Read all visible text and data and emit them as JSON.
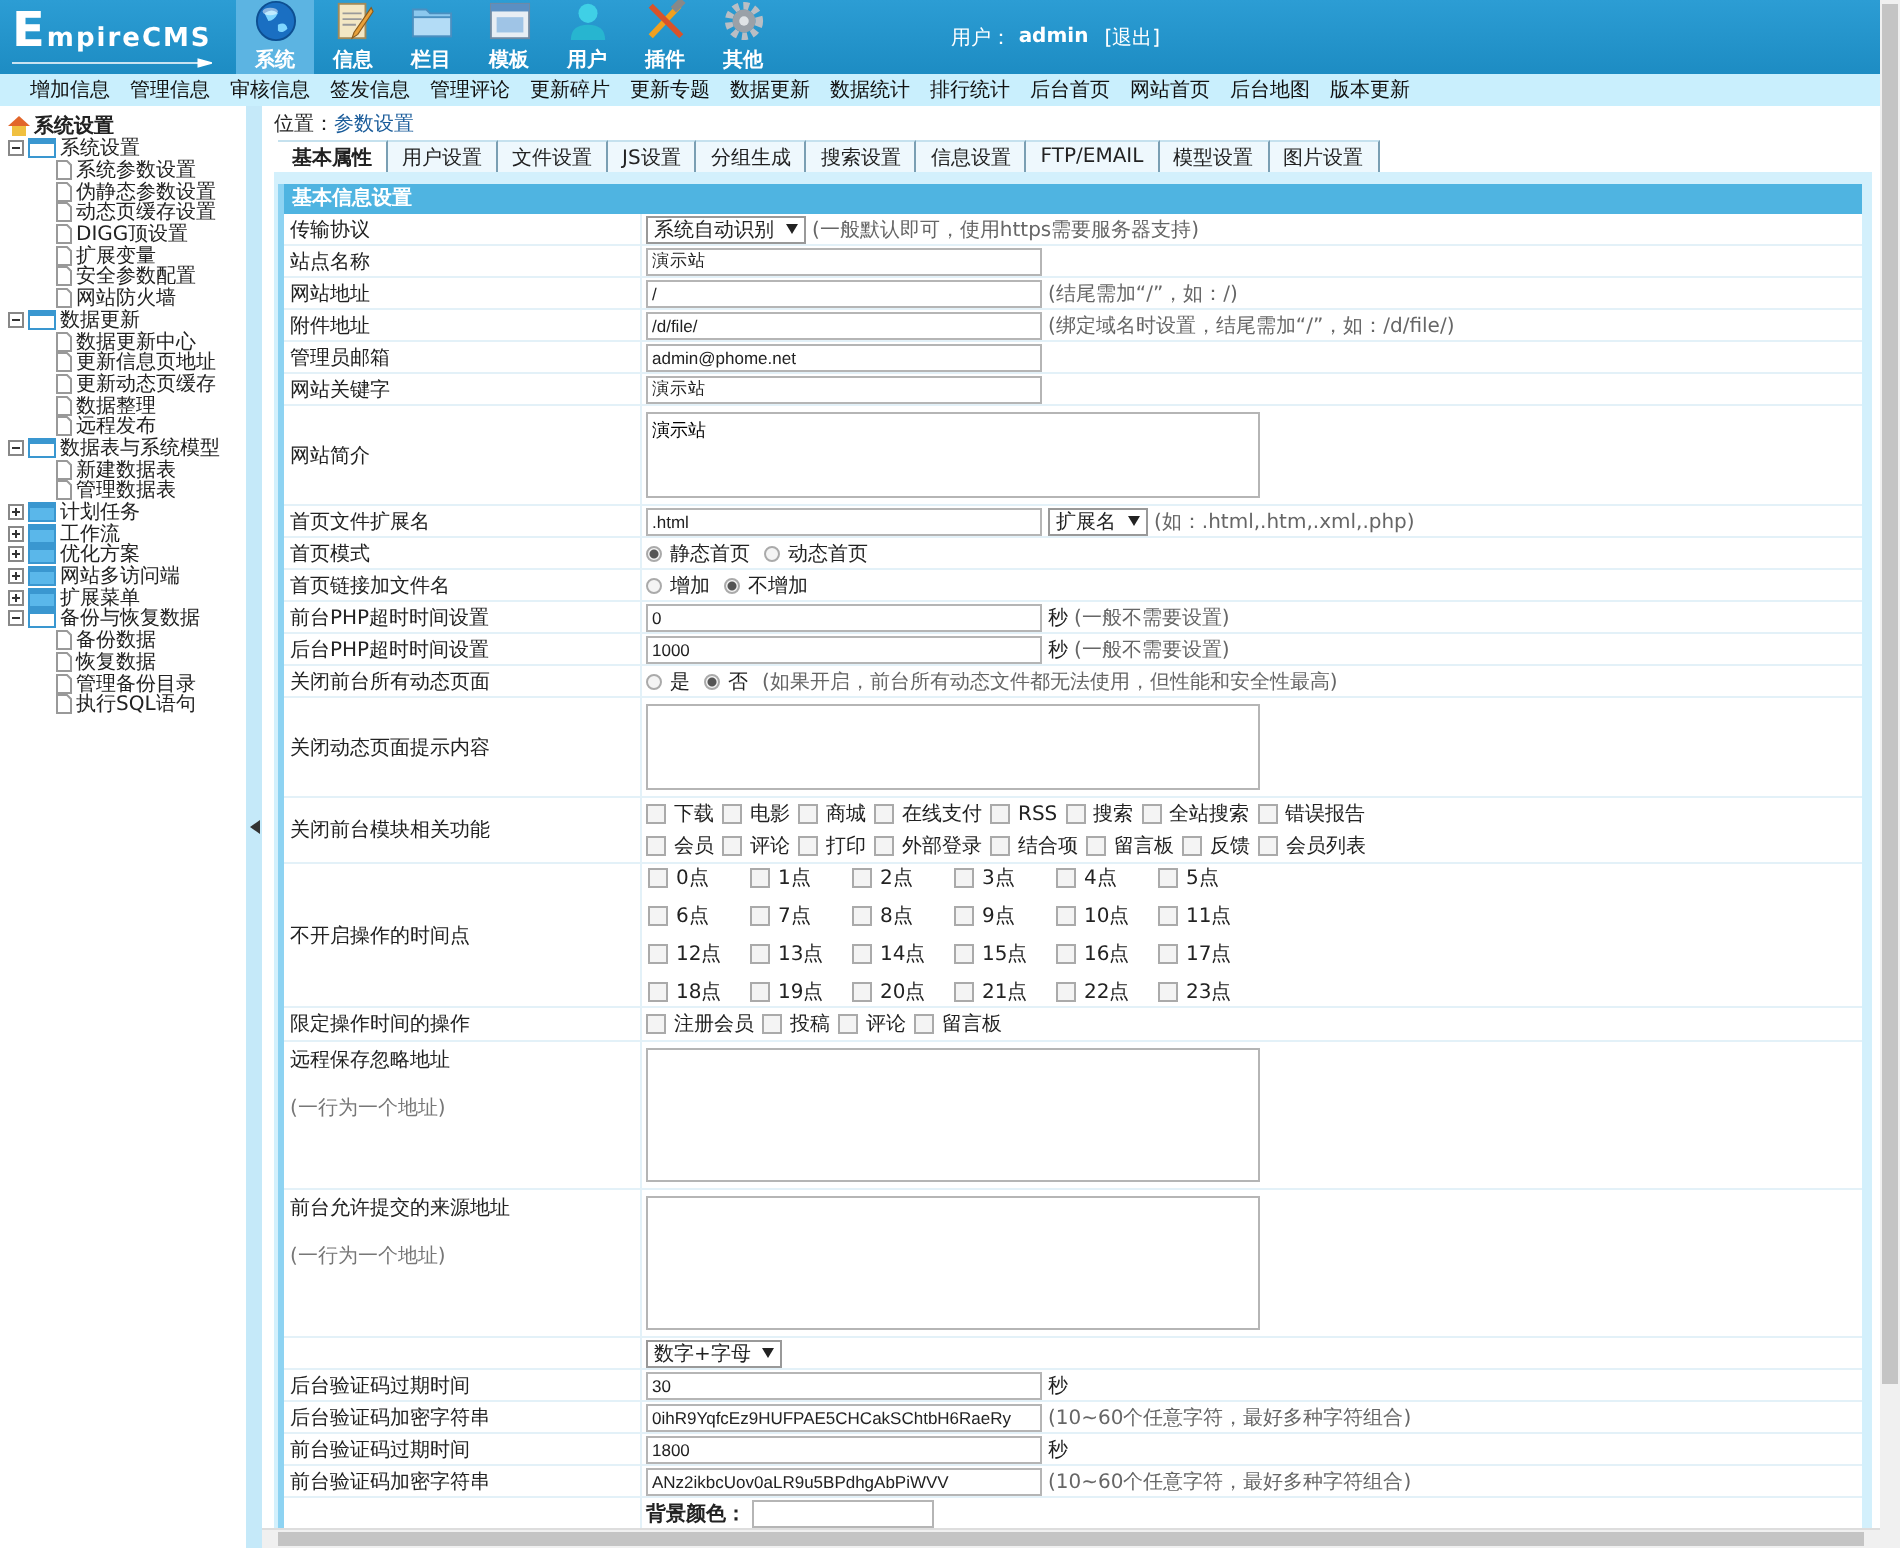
{
  "header": {
    "logo": "EmpireCMS",
    "modules": [
      {
        "label": "系统",
        "selected": true
      },
      {
        "label": "信息",
        "selected": false
      },
      {
        "label": "栏目",
        "selected": false
      },
      {
        "label": "模板",
        "selected": false
      },
      {
        "label": "用户",
        "selected": false
      },
      {
        "label": "插件",
        "selected": false
      },
      {
        "label": "其他",
        "selected": false
      }
    ],
    "user_label": "用户：",
    "user": "admin",
    "logout": "[退出]"
  },
  "menu": [
    "增加信息",
    "管理信息",
    "审核信息",
    "签发信息",
    "管理评论",
    "更新碎片",
    "更新专题",
    "数据更新",
    "数据统计",
    "排行统计",
    "后台首页",
    "网站首页",
    "后台地图",
    "版本更新"
  ],
  "sidebar": {
    "root": "系统设置",
    "items": [
      {
        "label": "系统设置",
        "expanded": true,
        "children": [
          {
            "label": "系统参数设置"
          },
          {
            "label": "伪静态参数设置"
          },
          {
            "label": "动态页缓存设置"
          },
          {
            "label": "DIGG顶设置"
          },
          {
            "label": "扩展变量"
          },
          {
            "label": "安全参数配置"
          },
          {
            "label": "网站防火墙"
          }
        ]
      },
      {
        "label": "数据更新",
        "expanded": true,
        "children": [
          {
            "label": "数据更新中心"
          },
          {
            "label": "更新信息页地址"
          },
          {
            "label": "更新动态页缓存"
          },
          {
            "label": "数据整理"
          },
          {
            "label": "远程发布"
          }
        ]
      },
      {
        "label": "数据表与系统模型",
        "expanded": true,
        "children": [
          {
            "label": "新建数据表"
          },
          {
            "label": "管理数据表"
          }
        ]
      },
      {
        "label": "计划任务",
        "expanded": false
      },
      {
        "label": "工作流",
        "expanded": false
      },
      {
        "label": "优化方案",
        "expanded": false
      },
      {
        "label": "网站多访问端",
        "expanded": false
      },
      {
        "label": "扩展菜单",
        "expanded": false
      },
      {
        "label": "备份与恢复数据",
        "expanded": true,
        "children": [
          {
            "label": "备份数据"
          },
          {
            "label": "恢复数据"
          },
          {
            "label": "管理备份目录"
          },
          {
            "label": "执行SQL语句"
          }
        ]
      }
    ]
  },
  "location": {
    "label": "位置：",
    "link": "参数设置"
  },
  "tabs": [
    {
      "label": "基本属性",
      "selected": true
    },
    {
      "label": "用户设置",
      "selected": false
    },
    {
      "label": "文件设置",
      "selected": false
    },
    {
      "label": "JS设置",
      "selected": false
    },
    {
      "label": "分组生成",
      "selected": false
    },
    {
      "label": "搜索设置",
      "selected": false
    },
    {
      "label": "信息设置",
      "selected": false
    },
    {
      "label": "FTP/EMAIL",
      "selected": false
    },
    {
      "label": "模型设置",
      "selected": false
    },
    {
      "label": "图片设置",
      "selected": false
    }
  ],
  "section_title": "基本信息设置",
  "rows": [
    {
      "kind": "select",
      "label": "传输协议",
      "value": "系统自动识别",
      "note": "(一般默认即可，使用https需要服务器支持)"
    },
    {
      "kind": "text",
      "label": "站点名称",
      "value": "演示站"
    },
    {
      "kind": "text",
      "label": "网站地址",
      "value": "/",
      "note": "(结尾需加“/”，如：/)"
    },
    {
      "kind": "text",
      "label": "附件地址",
      "value": "/d/file/",
      "note": "(绑定域名时设置，结尾需加“/”，如：/d/file/)"
    },
    {
      "kind": "text",
      "label": "管理员邮箱",
      "value": "admin@phome.net"
    },
    {
      "kind": "text",
      "label": "网站关键字",
      "value": "演示站"
    },
    {
      "kind": "textarea",
      "label": "网站简介",
      "value": "演示站"
    },
    {
      "kind": "text_select",
      "label": "首页文件扩展名",
      "value": ".html",
      "select": "扩展名",
      "note": "(如：.html,.htm,.xml,.php)"
    },
    {
      "kind": "radio",
      "label": "首页模式",
      "options": [
        {
          "label": "静态首页",
          "selected": true
        },
        {
          "label": "动态首页",
          "selected": false
        }
      ]
    },
    {
      "kind": "radio",
      "label": "首页链接加文件名",
      "options": [
        {
          "label": "增加",
          "selected": false
        },
        {
          "label": "不增加",
          "selected": true
        }
      ]
    },
    {
      "kind": "text",
      "label": "前台PHP超时时间设置",
      "value": "0",
      "unit": "秒",
      "note": "(一般不需要设置)"
    },
    {
      "kind": "text",
      "label": "后台PHP超时时间设置",
      "value": "1000",
      "unit": "秒",
      "note": "(一般不需要设置)"
    },
    {
      "kind": "radio",
      "label": "关闭前台所有动态页面",
      "options": [
        {
          "label": "是",
          "selected": false
        },
        {
          "label": "否",
          "selected": true
        }
      ],
      "note": "(如果开启，前台所有动态文件都无法使用，但性能和安全性最高)"
    },
    {
      "kind": "textarea",
      "label": "关闭动态页面提示内容"
    },
    {
      "kind": "checkboxes",
      "label": "关闭前台模块相关功能",
      "options": [
        {
          "label": "下载",
          "checked": false
        },
        {
          "label": "电影",
          "checked": false
        },
        {
          "label": "商城",
          "checked": false
        },
        {
          "label": "在线支付",
          "checked": false
        },
        {
          "label": "RSS",
          "checked": false
        },
        {
          "label": "搜索",
          "checked": false
        },
        {
          "label": "全站搜索",
          "checked": false
        },
        {
          "label": "错误报告",
          "checked": false
        },
        {
          "label": "会员",
          "checked": false
        },
        {
          "label": "评论",
          "checked": false
        },
        {
          "label": "打印",
          "checked": false
        },
        {
          "label": "外部登录",
          "checked": false
        },
        {
          "label": "结合项",
          "checked": false
        },
        {
          "label": "留言板",
          "checked": false
        },
        {
          "label": "反馈",
          "checked": false
        },
        {
          "label": "会员列表",
          "checked": false
        }
      ]
    },
    {
      "kind": "grid",
      "label": "不开启操作的时间点",
      "options": [
        {
          "label": "0点",
          "checked": false
        },
        {
          "label": "1点",
          "checked": false
        },
        {
          "label": "2点",
          "checked": false
        },
        {
          "label": "3点",
          "checked": false
        },
        {
          "label": "4点",
          "checked": false
        },
        {
          "label": "5点",
          "checked": false
        },
        {
          "label": "6点",
          "checked": false
        },
        {
          "label": "7点",
          "checked": false
        },
        {
          "label": "8点",
          "checked": false
        },
        {
          "label": "9点",
          "checked": false
        },
        {
          "label": "10点",
          "checked": false
        },
        {
          "label": "11点",
          "checked": false
        },
        {
          "label": "12点",
          "checked": false
        },
        {
          "label": "13点",
          "checked": false
        },
        {
          "label": "14点",
          "checked": false
        },
        {
          "label": "15点",
          "checked": false
        },
        {
          "label": "16点",
          "checked": false
        },
        {
          "label": "17点",
          "checked": false
        },
        {
          "label": "18点",
          "checked": false
        },
        {
          "label": "19点",
          "checked": false
        },
        {
          "label": "20点",
          "checked": false
        },
        {
          "label": "21点",
          "checked": false
        },
        {
          "label": "22点",
          "checked": false
        },
        {
          "label": "23点",
          "checked": false
        }
      ]
    },
    {
      "kind": "checkboxes",
      "label": "限定操作时间的操作",
      "options": [
        {
          "label": "注册会员",
          "checked": false
        },
        {
          "label": "投稿",
          "checked": false
        },
        {
          "label": "评论",
          "checked": false
        },
        {
          "label": "留言板",
          "checked": false
        }
      ]
    },
    {
      "kind": "tall_textarea",
      "label": "远程保存忽略地址",
      "sublabel": "(一行为一个地址)"
    },
    {
      "kind": "tall_textarea",
      "label": "前台允许提交的来源地址",
      "sublabel": "(一行为一个地址)"
    },
    {
      "kind": "select",
      "value": "数字+字母"
    },
    {
      "kind": "text",
      "label": "后台验证码过期时间",
      "value": "30",
      "unit": "秒"
    },
    {
      "kind": "text",
      "label": "后台验证码加密字符串",
      "value": "0ihR9YqfcEz9HUFPAE5CHCakSChtbH6RaeRy",
      "note": "(10~60个任意字符，最好多种字符组合)"
    },
    {
      "kind": "text",
      "label": "前台验证码过期时间",
      "value": "1800",
      "unit": "秒"
    },
    {
      "kind": "text",
      "label": "前台验证码加密字符串",
      "value": "ANz2ikbcUov0aLR9u5BPdhgAbPiWVV",
      "note": "(10~60个任意字符，最好多种字符组合)"
    },
    {
      "kind": "color",
      "field_label": "背景颜色："
    }
  ]
}
